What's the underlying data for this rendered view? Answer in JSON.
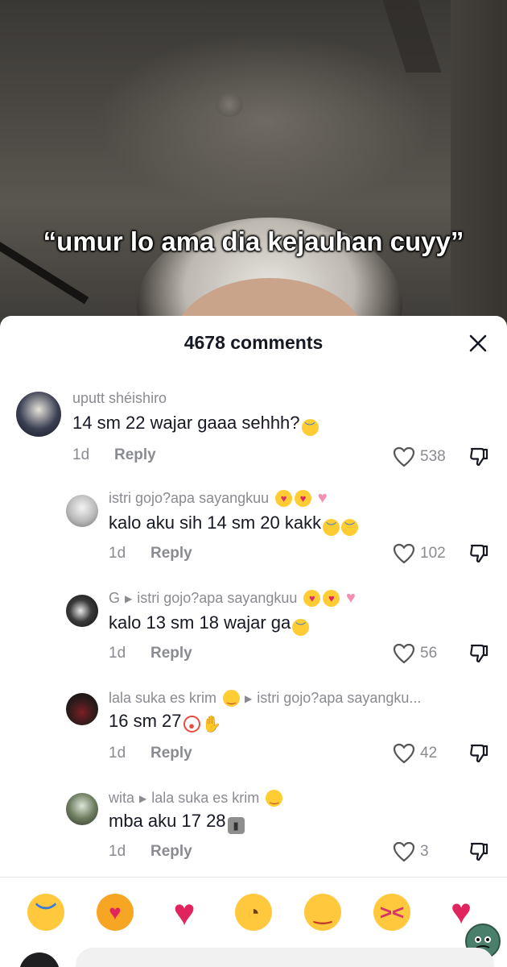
{
  "video": {
    "caption": "“umur lo ama dia kejauhan cuyy”"
  },
  "sheet": {
    "title": "4678 comments",
    "close_icon": "close-icon"
  },
  "comments": [
    {
      "username": "uputt shéishiro",
      "reply_to": "",
      "text": "14 sm 22 wajar gaaa sehhh?",
      "emojis": [
        "loudly-crying-face"
      ],
      "time": "1d",
      "reply_label": "Reply",
      "likes": "538"
    },
    {
      "username": "istri gojo?apa sayangkuu",
      "username_emojis": [
        "face-blowing-kiss",
        "smiling-face-with-heart-eyes",
        "pink-heart"
      ],
      "reply_to": "",
      "text": "kalo aku sih 14 sm 20 kakk",
      "emojis": [
        "loudly-crying-face",
        "loudly-crying-face"
      ],
      "time": "1d",
      "reply_label": "Reply",
      "likes": "102"
    },
    {
      "username": "G",
      "reply_to": "istri gojo?apa sayangkuu",
      "reply_to_emojis": [
        "face-blowing-kiss",
        "smiling-face-with-heart-eyes",
        "pink-heart"
      ],
      "text": "kalo 13 sm 18 wajar ga",
      "emojis": [
        "loudly-crying-face"
      ],
      "time": "1d",
      "reply_label": "Reply",
      "likes": "56"
    },
    {
      "username": "lala suka es krim",
      "username_emojis": [
        "face-savoring-food"
      ],
      "reply_to": "istri gojo?apa sayangku...",
      "text": "16 sm 27",
      "emojis": [
        "clown-face",
        "raised-hand"
      ],
      "time": "1d",
      "reply_label": "Reply",
      "likes": "42"
    },
    {
      "username": "wita",
      "reply_to": "lala suka es krim",
      "reply_to_emojis": [
        "face-savoring-food"
      ],
      "text": "mba aku 17 28",
      "emojis": [
        "moai"
      ],
      "time": "1d",
      "reply_label": "Reply",
      "likes": "3"
    }
  ],
  "emoji_bar": [
    "loudly-crying-face",
    "smiling-cat-with-heart-eyes",
    "red-heart",
    "pleading-face",
    "face-savoring-food",
    "squinting-face-with-tongue",
    "broken-heart"
  ],
  "colors": {
    "primary_text": "#161823",
    "secondary_text": "#8a8b91",
    "sheet_background": "#ffffff"
  }
}
